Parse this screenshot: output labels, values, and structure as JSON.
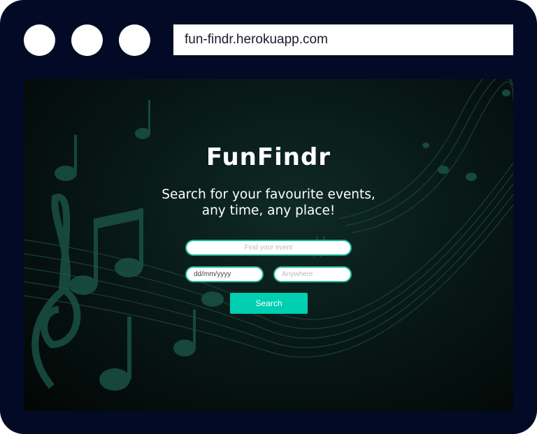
{
  "browser": {
    "url": "fun-findr.herokuapp.com"
  },
  "page": {
    "title": "FunFindr",
    "subtitle_line1": "Search for your favourite events,",
    "subtitle_line2": "any time, any place!",
    "event_placeholder": "Find your event",
    "date_value": "dd/mm/yyyy",
    "location_placeholder": "Anywhere",
    "search_label": "Search"
  },
  "colors": {
    "frame": "#020a26",
    "accent": "#00cfb2"
  }
}
